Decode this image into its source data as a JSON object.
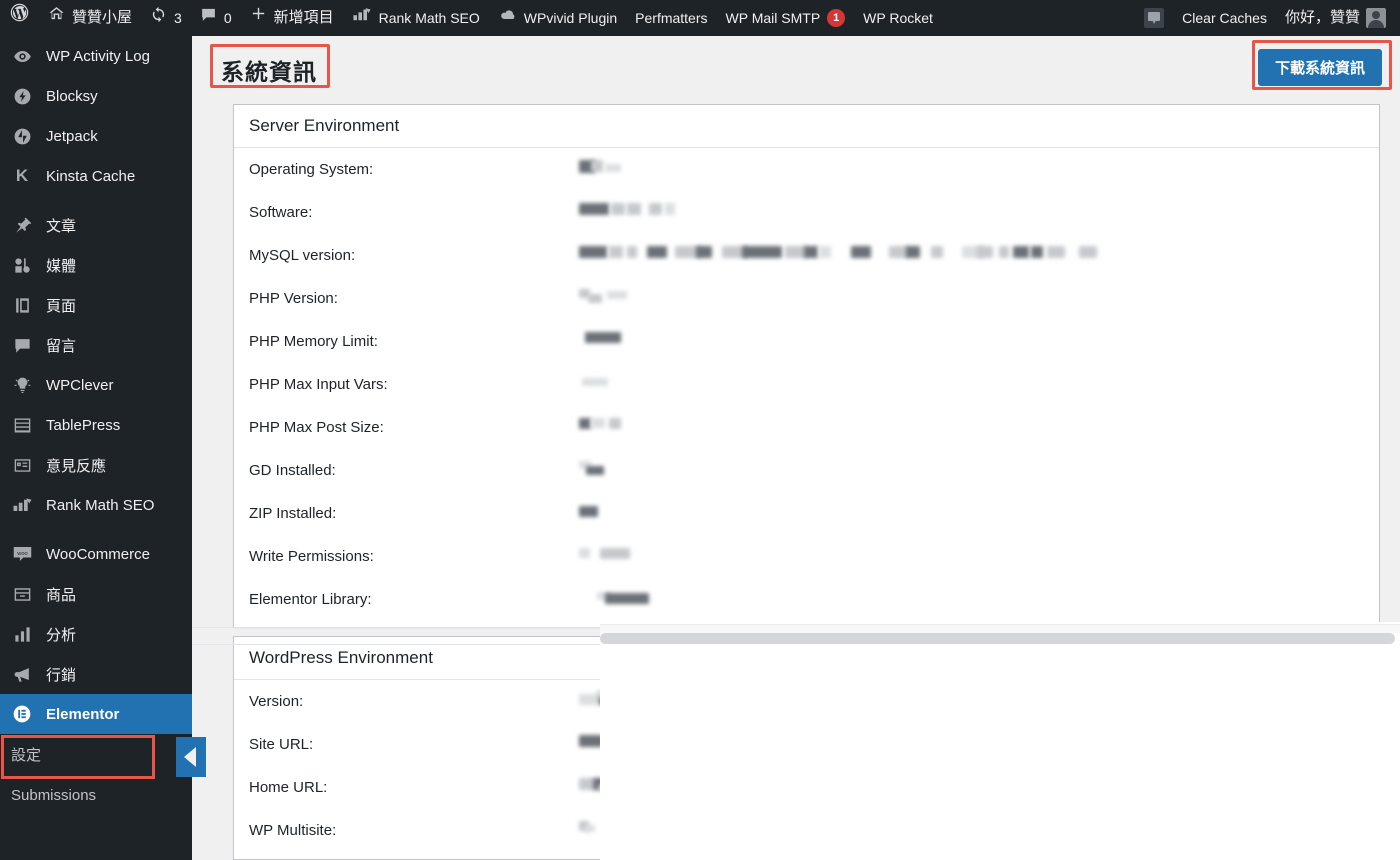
{
  "adminbar": {
    "left_items": [
      {
        "name": "wordpress-logo",
        "icon": "wordpress",
        "label": ""
      },
      {
        "name": "site-name",
        "icon": "home",
        "label": "贊贊小屋",
        "cjk": true
      },
      {
        "name": "updates",
        "icon": "update",
        "label": "3"
      },
      {
        "name": "comments",
        "icon": "comment",
        "label": "0"
      },
      {
        "name": "new-content",
        "icon": "plus",
        "label": "新增項目",
        "cjk": true
      },
      {
        "name": "rank-math-seo",
        "icon": "rankmath",
        "label": "Rank Math SEO"
      },
      {
        "name": "wpvivid-plugin",
        "icon": "cloud",
        "label": "WPvivid Plugin"
      },
      {
        "name": "perfmatters",
        "icon": "",
        "label": "Perfmatters"
      },
      {
        "name": "wp-mail-smtp",
        "icon": "",
        "label": "WP Mail SMTP",
        "badge": "1"
      },
      {
        "name": "wp-rocket",
        "icon": "",
        "label": "WP Rocket"
      }
    ],
    "right_items": [
      {
        "name": "feedback",
        "icon": "speech-square",
        "label": ""
      },
      {
        "name": "clear-caches",
        "icon": "",
        "label": "Clear Caches"
      },
      {
        "name": "howdy-user",
        "icon": "",
        "label": "你好，贊贊",
        "cjk": true
      },
      {
        "name": "user-avatar",
        "icon": "avatar",
        "label": ""
      }
    ]
  },
  "sidebar": {
    "items": [
      {
        "label": "WP Activity Log",
        "icon": "eye-icon",
        "cjk": false,
        "current": false
      },
      {
        "label": "Blocksy",
        "icon": "blocksy-icon",
        "cjk": false,
        "current": false
      },
      {
        "label": "Jetpack",
        "icon": "jetpack-icon",
        "cjk": false,
        "current": false
      },
      {
        "label": "Kinsta Cache",
        "icon": "kinsta-k-icon",
        "cjk": false,
        "current": false
      },
      {
        "separator": true
      },
      {
        "label": "文章",
        "icon": "pin-icon",
        "cjk": true,
        "current": false
      },
      {
        "label": "媒體",
        "icon": "media-icon",
        "cjk": true,
        "current": false
      },
      {
        "label": "頁面",
        "icon": "page-icon",
        "cjk": true,
        "current": false
      },
      {
        "label": "留言",
        "icon": "comment-icon",
        "cjk": true,
        "current": false
      },
      {
        "label": "WPClever",
        "icon": "bulb-icon",
        "cjk": false,
        "current": false
      },
      {
        "label": "TablePress",
        "icon": "table-icon",
        "cjk": false,
        "current": false
      },
      {
        "label": "意見反應",
        "icon": "feedback-icon",
        "cjk": true,
        "current": false
      },
      {
        "label": "Rank Math SEO",
        "icon": "rankmath-icon",
        "cjk": false,
        "current": false
      },
      {
        "separator": true
      },
      {
        "label": "WooCommerce",
        "icon": "woo-icon",
        "cjk": false,
        "current": false
      },
      {
        "label": "商品",
        "icon": "box-icon",
        "cjk": true,
        "current": false
      },
      {
        "label": "分析",
        "icon": "bars-icon",
        "cjk": true,
        "current": false
      },
      {
        "label": "行銷",
        "icon": "megaphone-icon",
        "cjk": true,
        "current": false
      },
      {
        "label": "Elementor",
        "icon": "elementor-icon",
        "cjk": false,
        "current": true
      }
    ],
    "submenu": [
      {
        "label": "設定"
      },
      {
        "label": "Submissions"
      }
    ]
  },
  "page": {
    "title": "系統資訊",
    "download_button": "下載系統資訊"
  },
  "sections": [
    {
      "title": "Server Environment",
      "rows": [
        {
          "label": "Operating System:",
          "blobs": [
            [
              0,
              36,
              12
            ],
            [
              33,
              30,
              7
            ]
          ]
        },
        {
          "label": "Software:",
          "blobs": [
            [
              0,
              52,
              12
            ],
            [
              55,
              25,
              12
            ],
            [
              88,
              12,
              12
            ],
            [
              104,
              14,
              9
            ]
          ]
        },
        {
          "label": "MySQL version:",
          "blobs": [
            [
              0,
              58,
              12
            ],
            [
              70,
              22,
              12
            ],
            [
              98,
              45,
              12
            ],
            [
              150,
              95,
              12
            ],
            [
              265,
              25,
              12
            ],
            [
              303,
              40,
              12
            ],
            [
              350,
              10,
              12
            ],
            [
              382,
              28,
              12
            ],
            [
              418,
              10,
              12
            ],
            [
              436,
              35,
              12
            ],
            [
              478,
              25,
              12
            ],
            [
              510,
              20,
              12
            ]
          ]
        },
        {
          "label": "PHP Version:",
          "blobs": [
            [
              0,
              14,
              10
            ],
            [
              10,
              18,
              8
            ],
            [
              38,
              22,
              7
            ]
          ]
        },
        {
          "label": "PHP Memory Limit:",
          "blobs": [
            [
              0,
              45,
              12
            ]
          ]
        },
        {
          "label": "PHP Max Input Vars:",
          "blobs": [
            [
              0,
              30,
              9
            ]
          ]
        },
        {
          "label": "PHP Max Post Size:",
          "blobs": [
            [
              0,
              18,
              11
            ],
            [
              26,
              20,
              9
            ],
            [
              50,
              12,
              11
            ]
          ]
        },
        {
          "label": "GD Installed:",
          "blobs": [
            [
              0,
              14,
              8
            ],
            [
              8,
              22,
              10
            ]
          ]
        },
        {
          "label": "ZIP Installed:",
          "blobs": [
            [
              0,
              22,
              11
            ]
          ]
        },
        {
          "label": "Write Permissions:",
          "blobs": [
            [
              0,
              12,
              10
            ],
            [
              22,
              38,
              11
            ]
          ]
        },
        {
          "label": "Elementor Library:",
          "blobs": [
            [
              18,
              14,
              8
            ],
            [
              24,
              52,
              11
            ]
          ]
        }
      ]
    },
    {
      "title": "WordPress Environment",
      "rows": [
        {
          "label": "Version:",
          "blobs": [
            [
              0,
              26,
              11
            ],
            [
              22,
              16,
              12
            ],
            [
              20,
              22,
              7
            ]
          ]
        },
        {
          "label": "Site URL:",
          "blobs": [
            [
              0,
              30,
              12
            ],
            [
              35,
              18,
              12
            ],
            [
              58,
              12,
              12
            ],
            [
              78,
              14,
              12
            ],
            [
              100,
              35,
              12
            ]
          ]
        },
        {
          "label": "Home URL:",
          "blobs": [
            [
              0,
              45,
              12
            ],
            [
              22,
              16,
              8
            ],
            [
              55,
              18,
              12
            ],
            [
              80,
              55,
              12
            ]
          ]
        },
        {
          "label": "WP Multisite:",
          "blobs": [
            [
              0,
              12,
              10
            ],
            [
              6,
              14,
              7
            ]
          ]
        }
      ]
    }
  ],
  "annotations": {
    "title_highlight_color": "#e8564a",
    "button_highlight_color": "#e8564a",
    "menu_highlight_color": "#e8564a",
    "accent_color": "#2271b1"
  }
}
